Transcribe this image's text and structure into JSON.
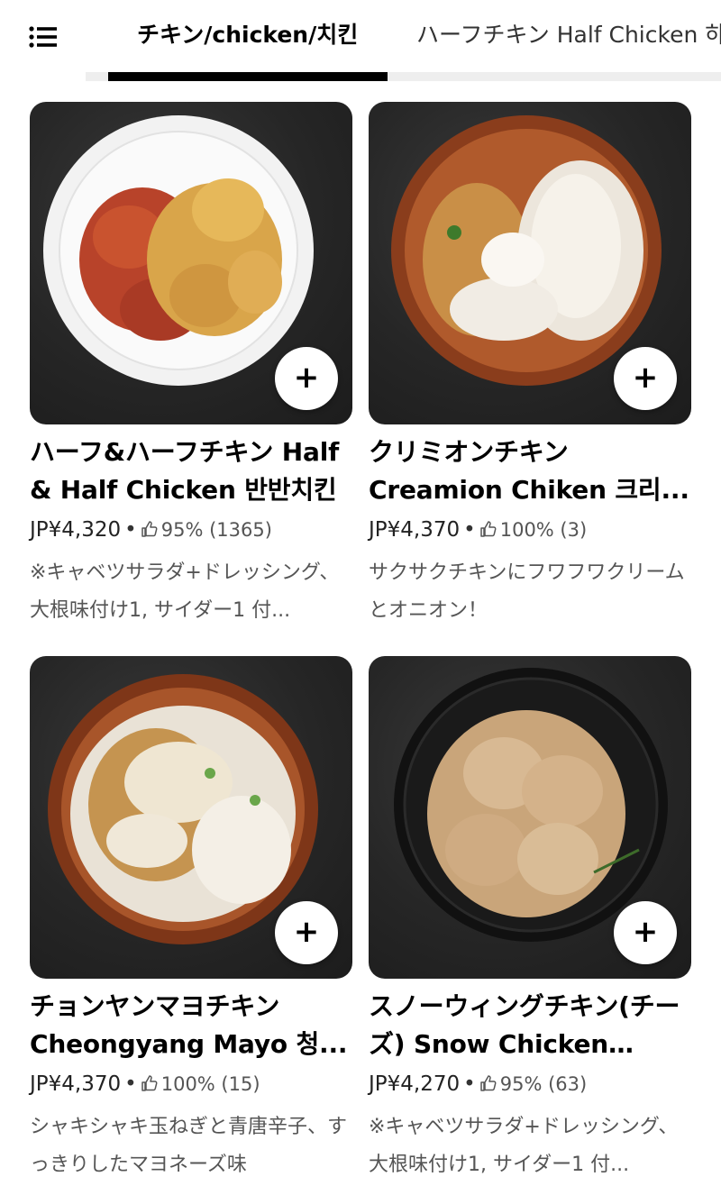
{
  "tabs": [
    {
      "label": "チキン/chicken/치킨",
      "active": true
    },
    {
      "label": "ハーフチキン Half Chicken 하",
      "active": false
    }
  ],
  "icons": {
    "menu": "list-icon",
    "add": "plus-icon",
    "thumb": "thumbs-up-icon"
  },
  "items": [
    {
      "title": "ハーフ&ハーフチキン Half & Half Chicken 반반치킨",
      "price": "JP¥4,320",
      "rating": "95% (1365)",
      "description": "※キャベツサラダ+ドレッシング、大根味付け1, サイダー1 付...",
      "plate": "white-plate"
    },
    {
      "title": "クリミオンチキン Creamion Chiken 크리...",
      "price": "JP¥4,370",
      "rating": "100% (3)",
      "description": "サクサクチキンにフワフワクリームとオニオン！",
      "plate": "wood-plate"
    },
    {
      "title": "チョンヤンマヨチキン Cheongyang Mayo 청...",
      "price": "JP¥4,370",
      "rating": "100% (15)",
      "description": "シャキシャキ玉ねぎと青唐辛子、すっきりしたマヨネーズ味",
      "plate": "wood-plate"
    },
    {
      "title": "スノーウィングチキン(チーズ) Snow Chicken (wit...",
      "price": "JP¥4,270",
      "rating": "95% (63)",
      "description": "※キャベツサラダ+ドレッシング、大根味付け1, サイダー1 付...",
      "plate": "black-plate"
    }
  ]
}
